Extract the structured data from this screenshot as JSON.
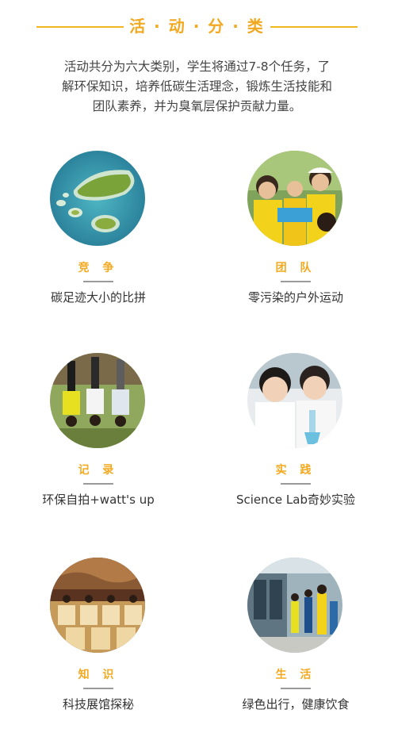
{
  "header": {
    "title": "活 · 动 · 分 · 类"
  },
  "intro": {
    "line1": "活动共分为六大类别，学生将通过7-8个任务，了",
    "line2": "解环保知识，培养低碳生活理念，锻炼生活技能和",
    "line3": "团队素养，并为臭氧层保护贡献力量。"
  },
  "categories": [
    {
      "title": "竞 争",
      "desc": "碳足迹大小的比拼"
    },
    {
      "title": "团 队",
      "desc": "零污染的户外运动"
    },
    {
      "title": "记 录",
      "desc": "环保自拍+watt's up"
    },
    {
      "title": "实 践",
      "desc": "Science Lab奇妙实验"
    },
    {
      "title": "知 识",
      "desc": "科技展馆探秘"
    },
    {
      "title": "生 活",
      "desc": "绿色出行，健康饮食"
    }
  ],
  "colors": {
    "accent": "#f3a91f",
    "line": "#f3b61f",
    "divider": "#9a9a9a"
  }
}
